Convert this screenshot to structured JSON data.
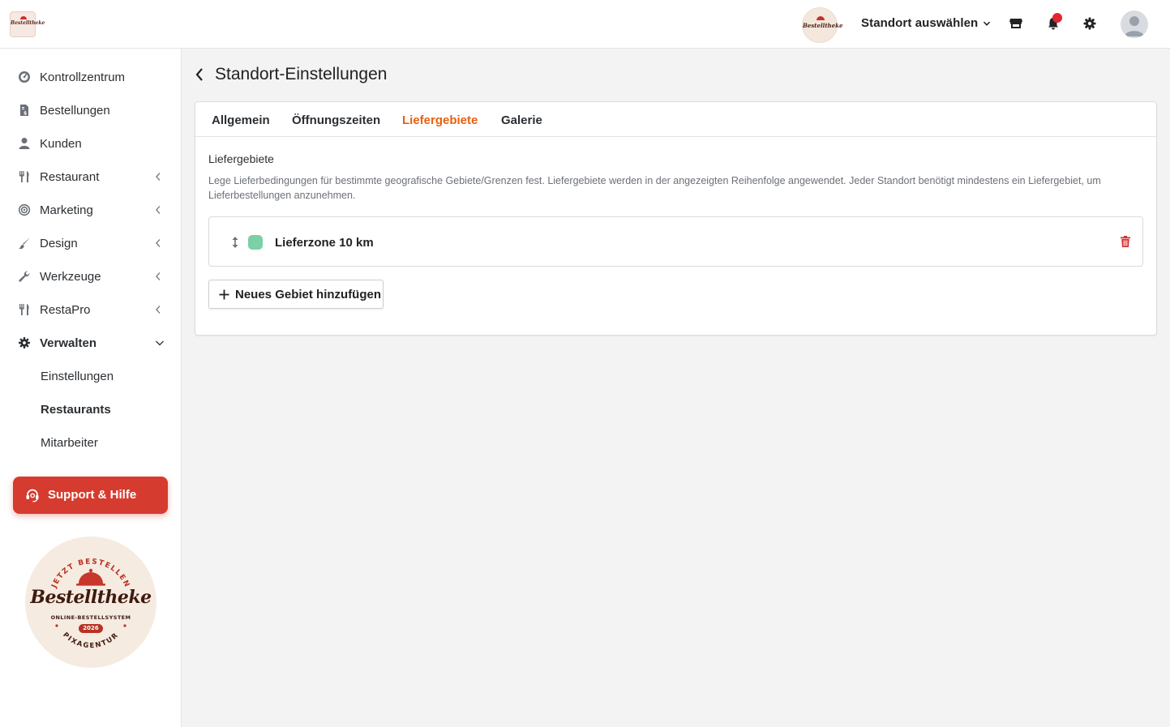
{
  "header": {
    "location_selector": "Standort auswählen",
    "icons": [
      "store-icon",
      "bell-icon",
      "gear-icon",
      "user-avatar-icon"
    ]
  },
  "logo": {
    "brand": "Bestelltheke",
    "arc_top": "JETZT BESTELLEN",
    "subtitle": "ONLINE-BESTELLSYSTEM",
    "year": "2026",
    "arc_bottom": "PIXAGENTUR"
  },
  "sidebar": {
    "items": [
      {
        "label": "Kontrollzentrum",
        "icon": "dashboard-icon"
      },
      {
        "label": "Bestellungen",
        "icon": "invoice-icon"
      },
      {
        "label": "Kunden",
        "icon": "user-icon"
      },
      {
        "label": "Restaurant",
        "icon": "cutlery-icon"
      },
      {
        "label": "Marketing",
        "icon": "target-icon"
      },
      {
        "label": "Design",
        "icon": "brush-icon"
      },
      {
        "label": "Werkzeuge",
        "icon": "wrench-icon"
      },
      {
        "label": "RestaPro",
        "icon": "cutlery-icon"
      },
      {
        "label": "Verwalten",
        "icon": "gear-icon"
      }
    ],
    "subitems": [
      {
        "label": "Einstellungen"
      },
      {
        "label": "Restaurants"
      },
      {
        "label": "Mitarbeiter"
      }
    ],
    "support_label": "Support & Hilfe"
  },
  "page": {
    "title": "Standort-Einstellungen",
    "tabs": [
      {
        "label": "Allgemein"
      },
      {
        "label": "Öffnungszeiten"
      },
      {
        "label": "Liefergebiete"
      },
      {
        "label": "Galerie"
      }
    ],
    "active_tab": "Liefergebiete",
    "section_title": "Liefergebiete",
    "section_description": "Lege Lieferbedingungen für bestimmte geografische Gebiete/Grenzen fest. Liefergebiete werden in der angezeigten Reihenfolge angewendet. Jeder Standort benötigt mindestens ein Liefergebiet, um Lieferbestellungen anzunehmen.",
    "zones": [
      {
        "name": "Lieferzone 10 km",
        "color": "#7ccfa6"
      }
    ],
    "add_button": "Neues Gebiet hinzufügen"
  },
  "colors": {
    "accent": "#e8600e",
    "support": "#d63b2f",
    "danger": "#d32f2f",
    "notification": "#e0262f"
  }
}
